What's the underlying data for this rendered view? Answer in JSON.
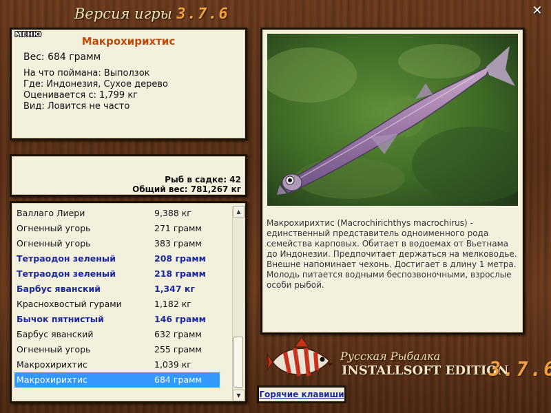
{
  "titlebar": {
    "title": "Версия игры",
    "version": "3.7.6"
  },
  "fish_info": {
    "name": "Макрохирихтис",
    "weight": "Вес: 684 грамм",
    "details": [
      "На что поймана: Выползок",
      "Где: Индонезия, Сухое дерево",
      "Оценивается с: 1,799 кг",
      "Вид: Ловится не часто"
    ]
  },
  "stats": {
    "fish_in_cage": "Рыб в садке: 42",
    "total_weight": "Общий вес: 781,267 кг",
    "menu_label": "МЕНЮ"
  },
  "catch_list": [
    {
      "name": "Валлаго Лиери",
      "weight": "9,388 кг",
      "bold": false,
      "selected": false
    },
    {
      "name": "Огненный угорь",
      "weight": "271 грамм",
      "bold": false,
      "selected": false
    },
    {
      "name": "Огненный угорь",
      "weight": "383 грамм",
      "bold": false,
      "selected": false
    },
    {
      "name": "Тетраодон зеленый",
      "weight": "208 грамм",
      "bold": true,
      "selected": false
    },
    {
      "name": "Тетраодон зеленый",
      "weight": "218 грамм",
      "bold": true,
      "selected": false
    },
    {
      "name": "Барбус яванский",
      "weight": "1,347 кг",
      "bold": true,
      "selected": false
    },
    {
      "name": "Краснохвостый гурами",
      "weight": "1,182 кг",
      "bold": false,
      "selected": false
    },
    {
      "name": "Бычок пятнистый",
      "weight": "146 грамм",
      "bold": true,
      "selected": false
    },
    {
      "name": "Барбус яванский",
      "weight": "632 грамм",
      "bold": false,
      "selected": false
    },
    {
      "name": "Огненный угорь",
      "weight": "255 грамм",
      "bold": false,
      "selected": false
    },
    {
      "name": "Макрохирихтис",
      "weight": "1,039 кг",
      "bold": false,
      "selected": false
    },
    {
      "name": "Макрохирихтис",
      "weight": "684 грамм",
      "bold": false,
      "selected": true
    }
  ],
  "description": "Макрохирихтис (Macrochirichthys macrochirus) - единственный представитель одноименного рода семейства карповых. Обитает в водоемах от Вьетнама до Индонезии. Предпочитает держаться на мелководье. Внешне напоминает чехонь. Достигает в длину 1 метра. Молодь питается водными беспозвоночными, взрослые особи рыбой.",
  "branding": {
    "line1": "Русская Рыбалка",
    "line2": "INSTALLSOFT EDITION",
    "version": "3.7.6"
  },
  "hotkeys_label": "Горячие клавиши",
  "icons": {
    "close": "close-icon",
    "scroll_up": "chevron-up-icon",
    "scroll_down": "chevron-down-icon",
    "brand_fish": "fish-logo-icon"
  },
  "colors": {
    "fish_name": "#c04a06",
    "bold_entry": "#1a2a9c",
    "selection": "#3399ff",
    "version_accent": "#f0a040"
  }
}
